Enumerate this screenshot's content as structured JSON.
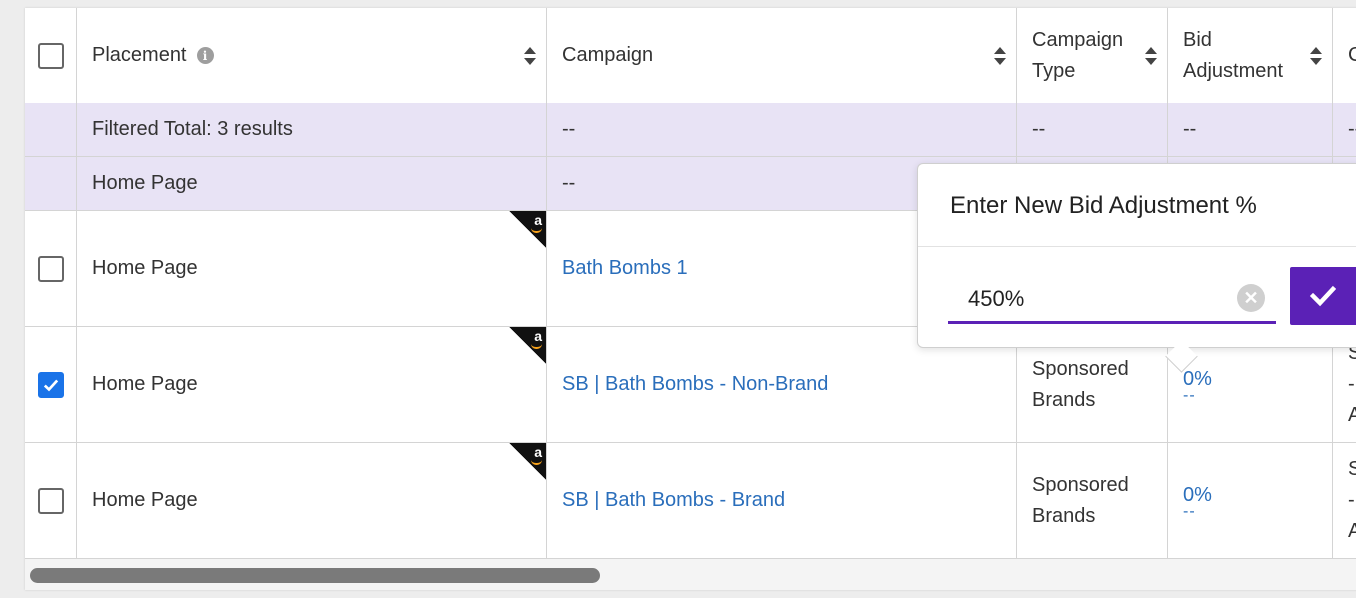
{
  "table": {
    "headers": {
      "placement": "Placement",
      "campaign": "Campaign",
      "campaign_type_line1": "Campaign",
      "campaign_type_line2": "Type",
      "bid_adjustment_line1": "Bid",
      "bid_adjustment_line2": "Adjustment",
      "next_col": "C"
    },
    "summary_rows": [
      {
        "placement": "Filtered Total: 3 results",
        "campaign": "--",
        "campaign_type": "--",
        "bid_adjustment": "--",
        "next": "--"
      },
      {
        "placement": "Home Page",
        "campaign": "--"
      }
    ],
    "rows": [
      {
        "checked": false,
        "placement": "Home Page",
        "campaign": "Bath Bombs 1",
        "badge": "a"
      },
      {
        "checked": true,
        "placement": "Home Page",
        "campaign": "SB | Bath Bombs - Non-Brand",
        "badge": "a",
        "campaign_type_line1": "Sponsored",
        "campaign_type_line2": "Brands",
        "bid_adjustment": "0%",
        "bid_sub": "--",
        "next_line1": "S",
        "next_line2": "-",
        "next_line3": "A"
      },
      {
        "checked": false,
        "placement": "Home Page",
        "campaign": "SB | Bath Bombs - Brand",
        "badge": "a",
        "campaign_type_line1": "Sponsored",
        "campaign_type_line2": "Brands",
        "bid_adjustment": "0%",
        "bid_sub": "--",
        "next_line1": "S",
        "next_line2": "-",
        "next_line3": "A"
      }
    ]
  },
  "popover": {
    "title": "Enter New Bid Adjustment %",
    "input_value": "450%"
  },
  "icons": {
    "info": "info-icon",
    "sort": "sort-icon",
    "clear": "clear-circle-icon",
    "confirm": "checkmark-icon",
    "amazon": "amazon-badge-icon"
  },
  "colors": {
    "accent": "#5b21b6",
    "link": "#2a6ebb",
    "summary_bg": "#e8e3f5",
    "checkbox_checked": "#1a73e8"
  }
}
